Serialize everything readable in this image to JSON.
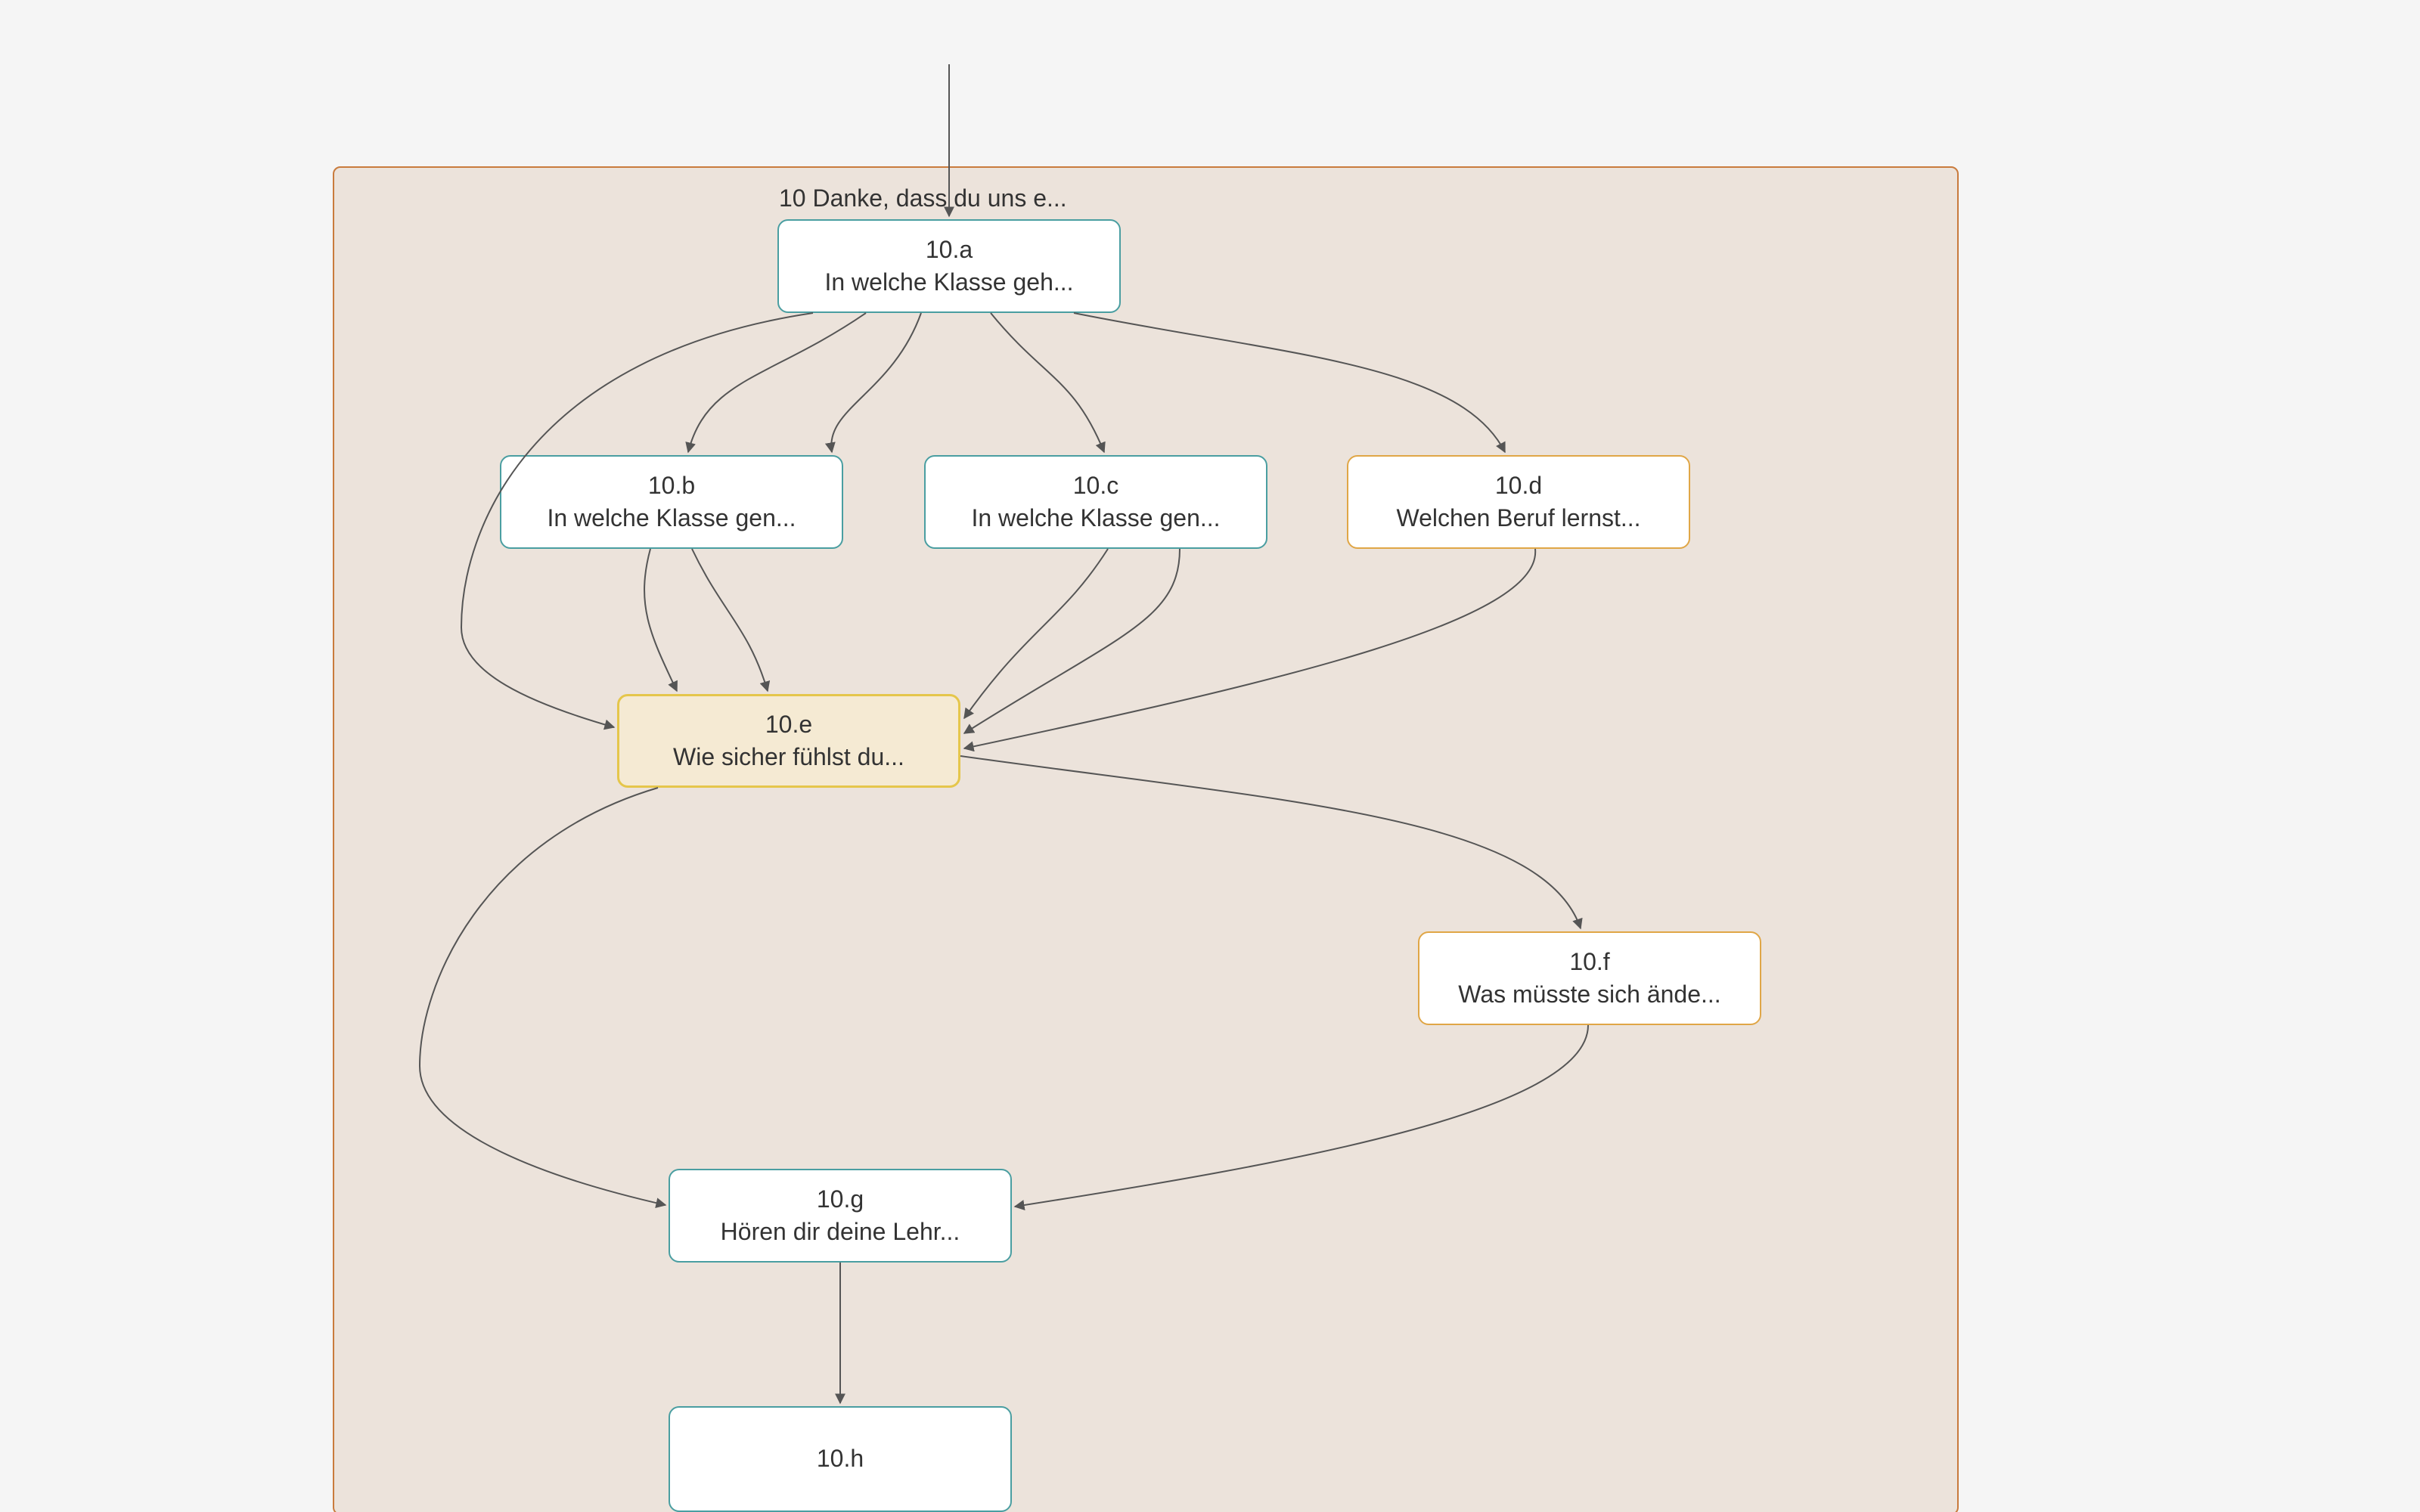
{
  "group": {
    "title": "10 Danke, dass du uns e..."
  },
  "nodes": {
    "a": {
      "id": "10.a",
      "text": "In welche Klasse geh..."
    },
    "b": {
      "id": "10.b",
      "text": "In welche Klasse gen..."
    },
    "c": {
      "id": "10.c",
      "text": "In welche Klasse gen..."
    },
    "d": {
      "id": "10.d",
      "text": "Welchen Beruf lernst..."
    },
    "e": {
      "id": "10.e",
      "text": "Wie sicher fühlst du..."
    },
    "f": {
      "id": "10.f",
      "text": "Was müsste sich ände..."
    },
    "g": {
      "id": "10.g",
      "text": "Hören dir deine Lehr..."
    },
    "h": {
      "id": "10.h",
      "text": ""
    }
  }
}
